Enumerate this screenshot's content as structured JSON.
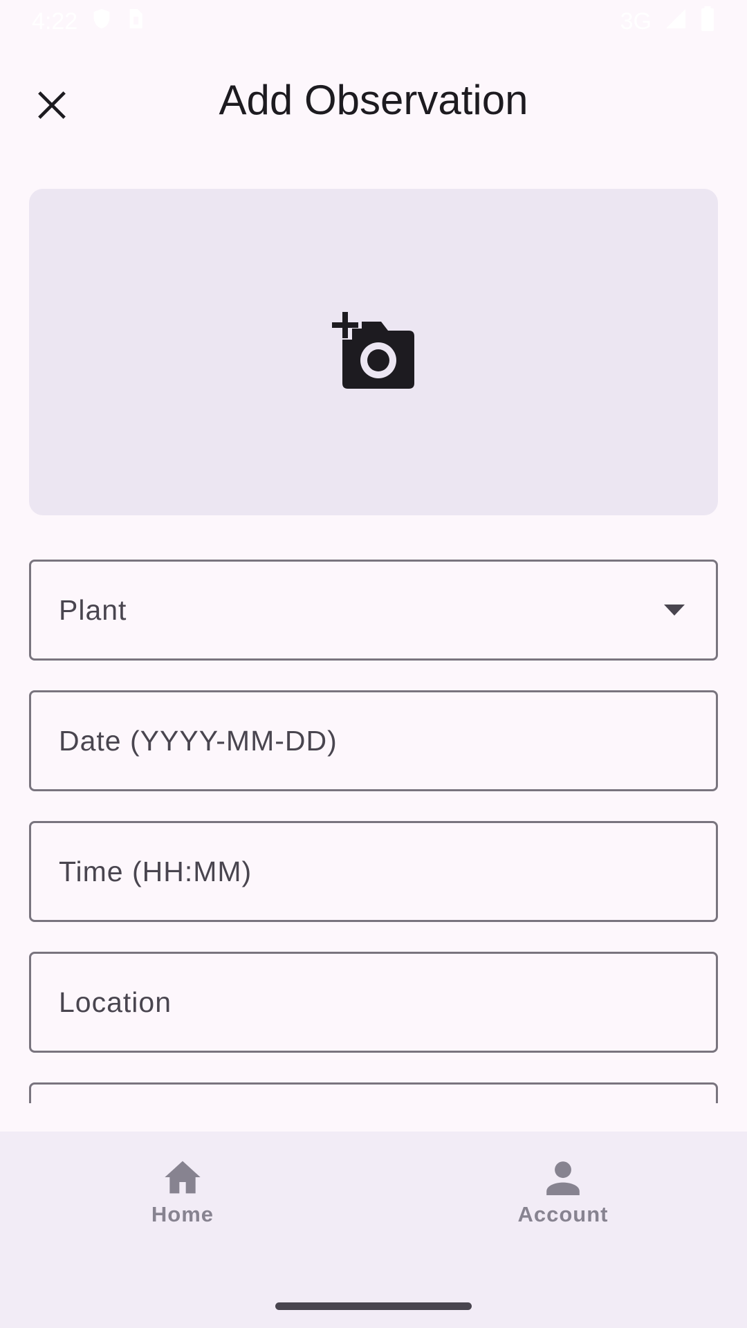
{
  "status_bar": {
    "time": "4:22",
    "network": "3G"
  },
  "header": {
    "title": "Add Observation",
    "close_icon": "close-icon"
  },
  "photo": {
    "icon": "add-photo-icon"
  },
  "form": {
    "plant_label": "Plant",
    "date_label": "Date (YYYY-MM-DD)",
    "time_label": "Time (HH:MM)",
    "location_label": "Location"
  },
  "nav": {
    "items": [
      {
        "label": "Home",
        "icon": "home-icon"
      },
      {
        "label": "Account",
        "icon": "account-icon"
      }
    ]
  },
  "colors": {
    "background": "#fdf7fc",
    "card": "#ece6f2",
    "outline": "#79747e",
    "nav_background": "#f2ecf6",
    "nav_label": "#878390"
  }
}
